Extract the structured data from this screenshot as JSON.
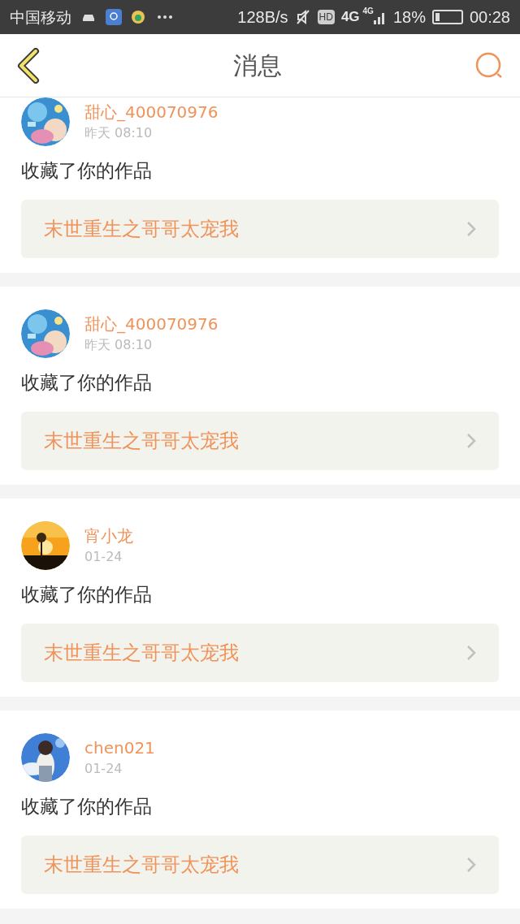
{
  "status_bar": {
    "carrier": "中国移动",
    "speed": "128B/s",
    "hd": "HD",
    "network": "4G",
    "signal_label": "4G",
    "battery": "18%",
    "time": "00:28"
  },
  "header": {
    "title": "消息"
  },
  "messages": [
    {
      "user": "甜心_400070976",
      "time": "昨天 08:10",
      "text": "收藏了你的作品",
      "work": "末世重生之哥哥太宠我"
    },
    {
      "user": "甜心_400070976",
      "time": "昨天 08:10",
      "text": "收藏了你的作品",
      "work": "末世重生之哥哥太宠我"
    },
    {
      "user": "宵小龙",
      "time": "01-24",
      "text": "收藏了你的作品",
      "work": "末世重生之哥哥太宠我"
    },
    {
      "user": "chen021",
      "time": "01-24",
      "text": "收藏了你的作品",
      "work": "末世重生之哥哥太宠我"
    }
  ]
}
